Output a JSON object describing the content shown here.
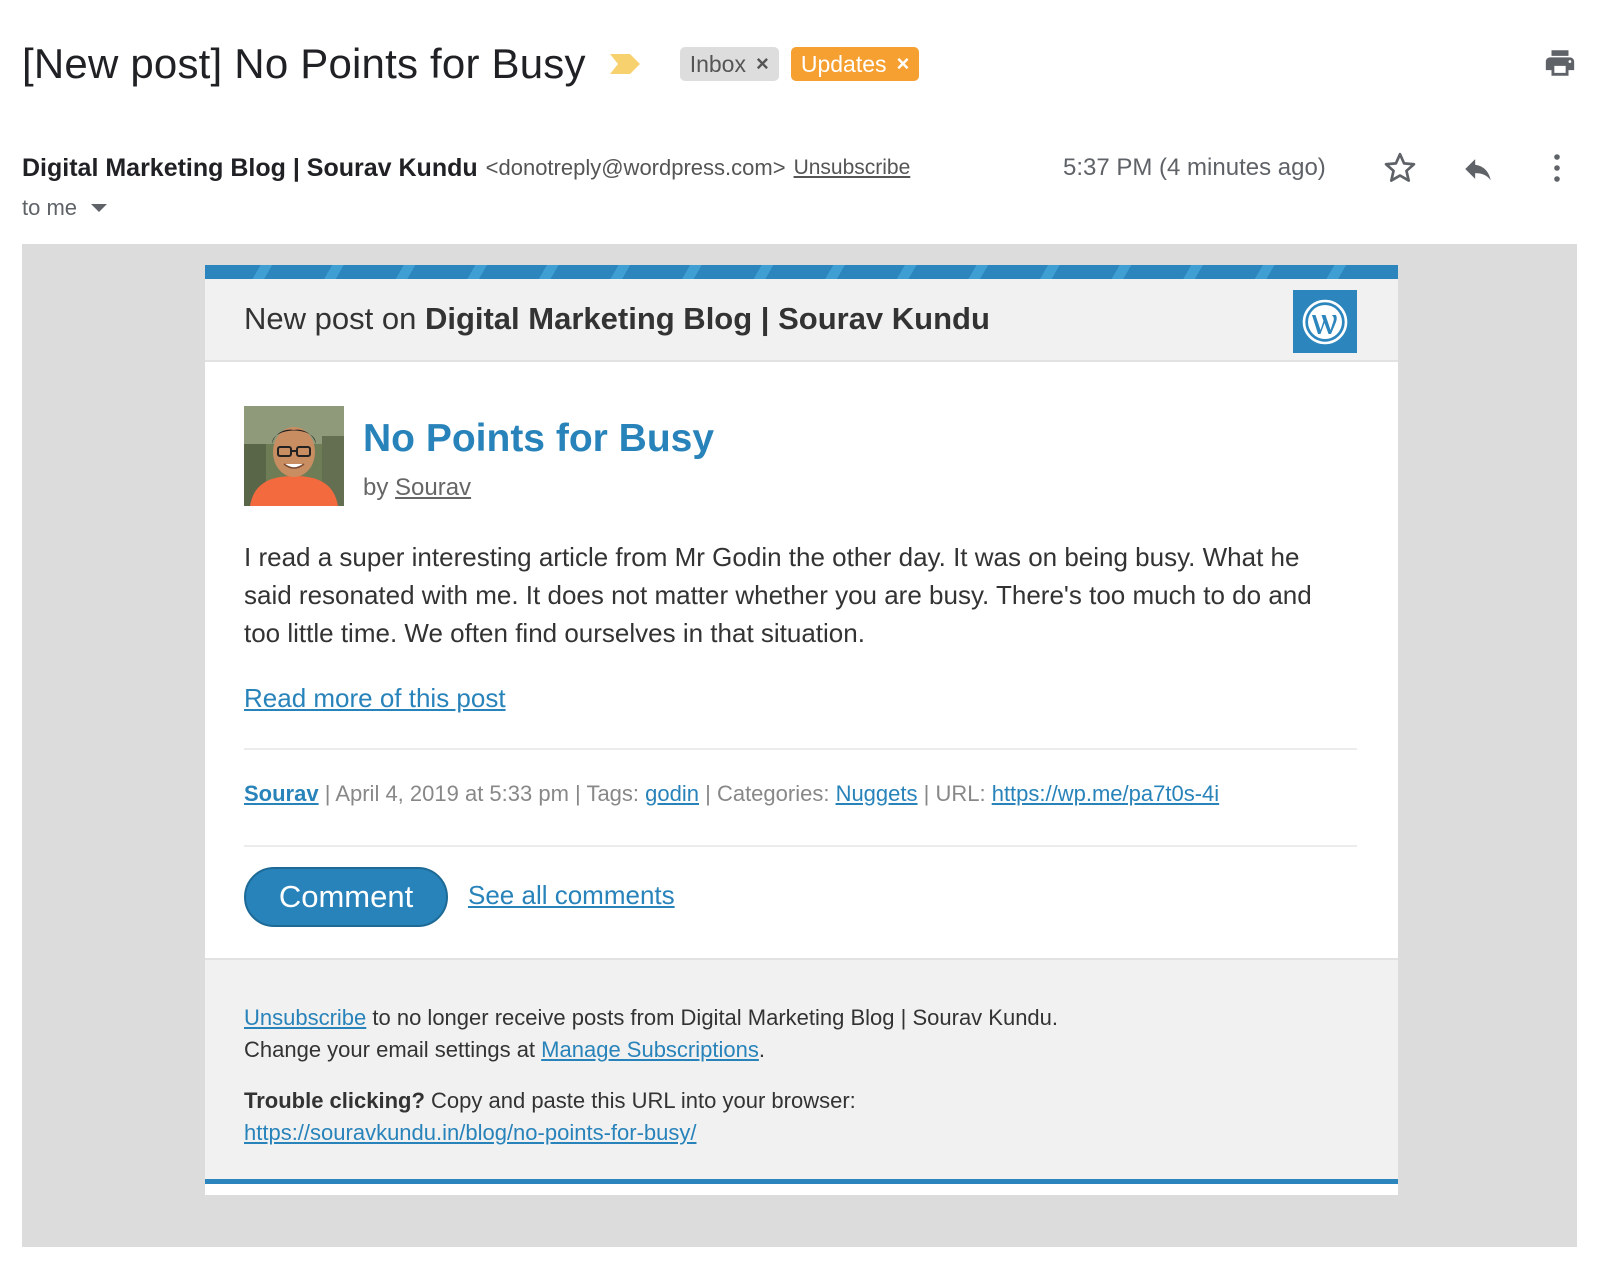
{
  "subject": {
    "title": "[New post] No Points for Busy",
    "labels": [
      {
        "text": "Inbox",
        "remove": "×"
      },
      {
        "text": "Updates",
        "remove": "×"
      }
    ]
  },
  "sender": {
    "name": "Digital Marketing Blog | Sourav Kundu",
    "email": "<donotreply@wordpress.com>",
    "unsubscribe_label": "Unsubscribe",
    "timestamp": "5:37 PM (4 minutes ago)",
    "recipient": "to me"
  },
  "icons": {
    "importance": "importance-marker-icon",
    "print": "print-icon",
    "star": "star-icon",
    "reply": "reply-icon",
    "more": "more-vert-icon",
    "logo": "wordpress-logo-icon"
  },
  "email": {
    "header_prefix": "New post on ",
    "header_blog": "Digital Marketing Blog | Sourav Kundu",
    "post_title": "No Points for Busy",
    "byline_prefix": "by ",
    "author": "Sourav",
    "excerpt": "I read a super interesting article from Mr Godin the other day. It was on being busy. What he said resonated with me. It does not matter whether you are busy. There's too much to do and too little time. We often find ourselves in that situation.",
    "read_more": "Read more of this post",
    "meta": {
      "author": "Sourav",
      "date": " | April 4, 2019 at 5:33 pm | Tags: ",
      "tag": "godin",
      "categories_label": " | Categories: ",
      "category": "Nuggets",
      "url_label": " | URL: ",
      "short_url": "https://wp.me/pa7t0s-4i"
    },
    "comment_button": "Comment",
    "see_all_comments": "See all comments",
    "footer": {
      "unsubscribe_link": "Unsubscribe",
      "unsubscribe_text": " to no longer receive posts from Digital Marketing Blog | Sourav Kundu.",
      "settings_text": "Change your email settings at ",
      "manage_link": "Manage Subscriptions",
      "settings_end": ".",
      "trouble_bold": "Trouble clicking?",
      "trouble_text": " Copy and paste this URL into your browser:",
      "post_url": "https://souravkundu.in/blog/no-points-for-busy/"
    }
  },
  "colors": {
    "accent": "#2883ba",
    "updates_label": "#f6a031",
    "inbox_label": "#dddddd",
    "importance": "#f7d16d"
  }
}
